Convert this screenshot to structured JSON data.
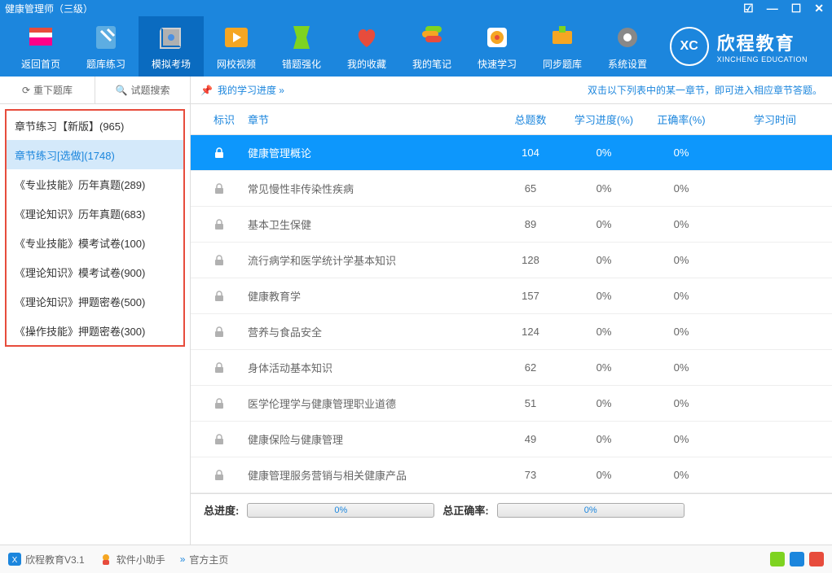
{
  "titlebar": {
    "title": "健康管理师（三级）"
  },
  "toolbar": {
    "items": [
      {
        "label": "返回首页"
      },
      {
        "label": "题库练习"
      },
      {
        "label": "模拟考场"
      },
      {
        "label": "网校视频"
      },
      {
        "label": "错题强化"
      },
      {
        "label": "我的收藏"
      },
      {
        "label": "我的笔记"
      },
      {
        "label": "快速学习"
      },
      {
        "label": "同步题库"
      },
      {
        "label": "系统设置"
      }
    ]
  },
  "brand": {
    "abbr": "XC",
    "cn": "欣程教育",
    "en": "XINCHENG EDUCATION"
  },
  "sidebarTop": {
    "reload": "重下题库",
    "search": "试题搜索"
  },
  "sidebar": {
    "items": [
      {
        "label": "章节练习【新版】(965)"
      },
      {
        "label": "章节练习[选做](1748)"
      },
      {
        "label": "《专业技能》历年真题(289)"
      },
      {
        "label": "《理论知识》历年真题(683)"
      },
      {
        "label": "《专业技能》模考试卷(100)"
      },
      {
        "label": "《理论知识》模考试卷(900)"
      },
      {
        "label": "《理论知识》押题密卷(500)"
      },
      {
        "label": "《操作技能》押题密卷(300)"
      }
    ]
  },
  "mainHeader": {
    "progress": "我的学习进度 »",
    "hint": "双击以下列表中的某一章节，即可进入相应章节答题。"
  },
  "table": {
    "headers": {
      "mark": "标识",
      "chapter": "章节",
      "total": "总题数",
      "progress": "学习进度(%)",
      "correct": "正确率(%)",
      "time": "学习时间"
    },
    "rows": [
      {
        "chapter": "健康管理概论",
        "total": "104",
        "progress": "0%",
        "correct": "0%"
      },
      {
        "chapter": "常见慢性非传染性疾病",
        "total": "65",
        "progress": "0%",
        "correct": "0%"
      },
      {
        "chapter": "基本卫生保健",
        "total": "89",
        "progress": "0%",
        "correct": "0%"
      },
      {
        "chapter": "流行病学和医学统计学基本知识",
        "total": "128",
        "progress": "0%",
        "correct": "0%"
      },
      {
        "chapter": "健康教育学",
        "total": "157",
        "progress": "0%",
        "correct": "0%"
      },
      {
        "chapter": "营养与食品安全",
        "total": "124",
        "progress": "0%",
        "correct": "0%"
      },
      {
        "chapter": "身体活动基本知识",
        "total": "62",
        "progress": "0%",
        "correct": "0%"
      },
      {
        "chapter": "医学伦理学与健康管理职业道德",
        "total": "51",
        "progress": "0%",
        "correct": "0%"
      },
      {
        "chapter": "健康保险与健康管理",
        "total": "49",
        "progress": "0%",
        "correct": "0%"
      },
      {
        "chapter": "健康管理服务营销与相关健康产品",
        "total": "73",
        "progress": "0%",
        "correct": "0%"
      }
    ]
  },
  "summary": {
    "totalProgressLabel": "总进度:",
    "totalProgress": "0%",
    "totalCorrectLabel": "总正确率:",
    "totalCorrect": "0%"
  },
  "statusbar": {
    "appVersion": "欣程教育V3.1",
    "helper": "软件小助手",
    "arrow": "»",
    "homepage": "官方主页"
  }
}
